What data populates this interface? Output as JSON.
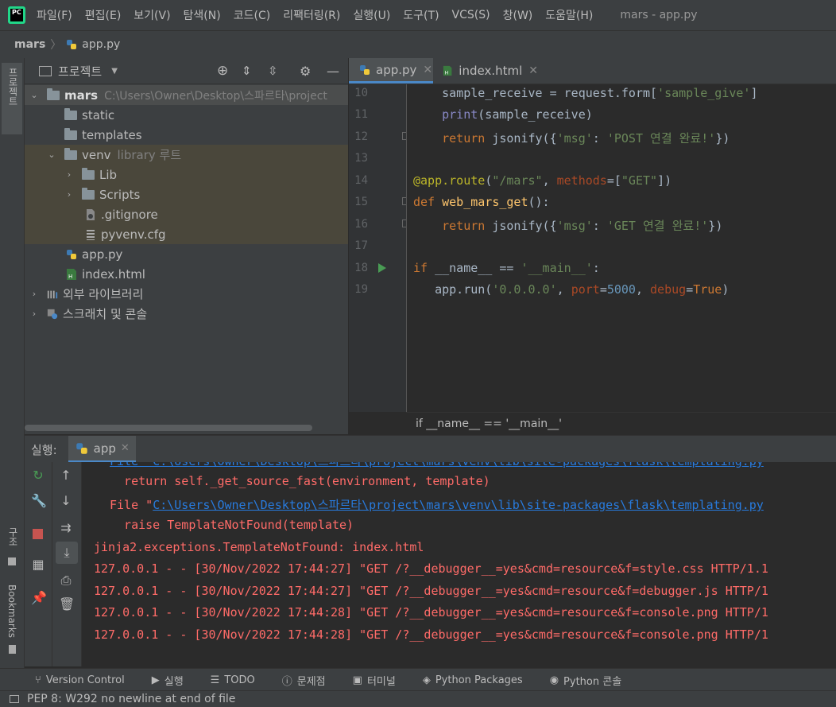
{
  "menu": {
    "items": [
      "파일(F)",
      "편집(E)",
      "보기(V)",
      "탐색(N)",
      "코드(C)",
      "리팩터링(R)",
      "실행(U)",
      "도구(T)",
      "VCS(S)",
      "창(W)",
      "도움말(H)"
    ],
    "window_title": "mars - app.py"
  },
  "breadcrumb": {
    "project": "mars",
    "file": "app.py"
  },
  "left_stripe": {
    "project_label": "프로젝트",
    "structure_label": "구조",
    "bookmarks_label": "Bookmarks"
  },
  "project_panel": {
    "title": "프로젝트",
    "root_name": "mars",
    "root_path": "C:\\Users\\Owner\\Desktop\\스파르타\\project",
    "static": "static",
    "templates": "templates",
    "venv": "venv",
    "venv_note": "library 루트",
    "lib": "Lib",
    "scripts": "Scripts",
    "gitignore": ".gitignore",
    "pyvenv": "pyvenv.cfg",
    "app_py": "app.py",
    "index_html": "index.html",
    "external_libs": "외부 라이브러리",
    "scratches": "스크래치 및 콘솔"
  },
  "tabs": [
    {
      "label": "app.py"
    },
    {
      "label": "index.html"
    }
  ],
  "editor": {
    "line_numbers": [
      "10",
      "11",
      "12",
      "13",
      "14",
      "15",
      "16",
      "17",
      "18",
      "19"
    ],
    "status": "if __name__ == '__main__'"
  },
  "run_panel": {
    "label": "실행:",
    "tab": "app"
  },
  "console": {
    "l1": "File \"C:\\Users\\Owner\\Desktop\\스파르타\\project\\mars\\venv\\lib\\site-packages\\flask\\templating.py",
    "l2": "  return self._get_source_fast(environment, template)",
    "l3_prefix": "File \"",
    "l3_link": "C:\\Users\\Owner\\Desktop\\스파르타\\project\\mars\\venv\\lib\\site-packages\\flask\\templating.py",
    "l4": "  raise TemplateNotFound(template)",
    "l5": "jinja2.exceptions.TemplateNotFound: index.html",
    "l6": "127.0.0.1 - - [30/Nov/2022 17:44:27] \"GET /?__debugger__=yes&cmd=resource&f=style.css HTTP/1.1",
    "l7": "127.0.0.1 - - [30/Nov/2022 17:44:27] \"GET /?__debugger__=yes&cmd=resource&f=debugger.js HTTP/1",
    "l8": "127.0.0.1 - - [30/Nov/2022 17:44:28] \"GET /?__debugger__=yes&cmd=resource&f=console.png HTTP/1",
    "l9": "127.0.0.1 - - [30/Nov/2022 17:44:28] \"GET /?__debugger__=yes&cmd=resource&f=console.png HTTP/1"
  },
  "toolwindows": {
    "version_control": "Version Control",
    "run": "실행",
    "todo": "TODO",
    "problems": "문제점",
    "terminal": "터미널",
    "python_packages": "Python Packages",
    "python_console": "Python 콘솔"
  },
  "status_bar": {
    "message": "PEP 8: W292 no newline at end of file"
  },
  "colors": {
    "accent": "#4a88c7",
    "error_text": "#ff6b68",
    "link": "#287bde",
    "keyword": "#cc7832",
    "string": "#6a8759"
  }
}
